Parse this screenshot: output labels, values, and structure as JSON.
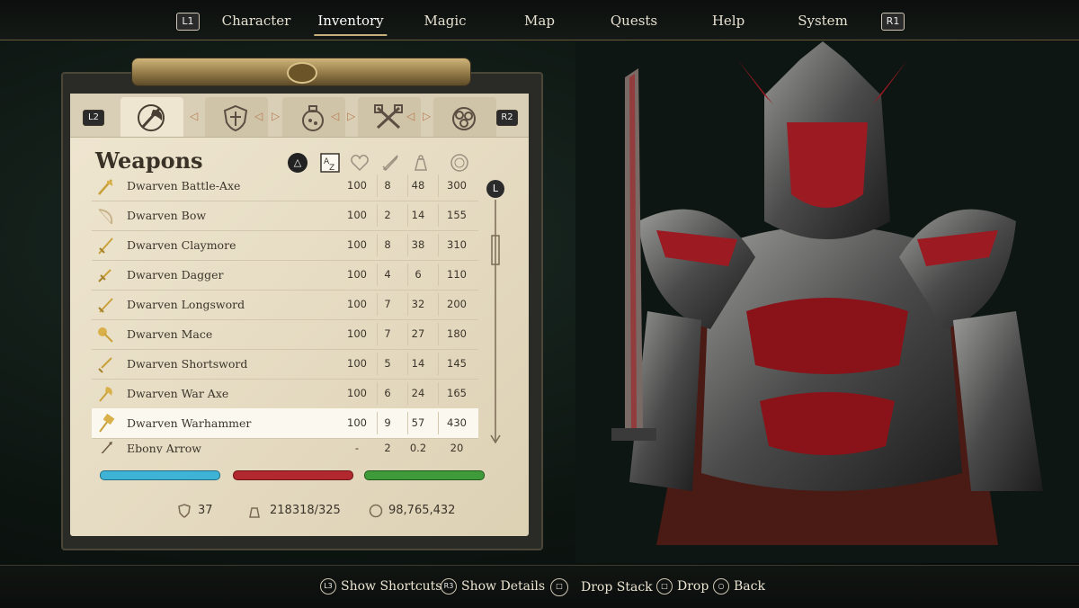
{
  "nav": {
    "left_button": "L1",
    "right_button": "R1",
    "tabs": [
      "Character",
      "Inventory",
      "Magic",
      "Map",
      "Quests",
      "Help",
      "System"
    ],
    "active_tab": "Inventory"
  },
  "panel": {
    "left_shoulder": "L2",
    "right_shoulder": "R2",
    "categories": [
      {
        "icon": "weapons-axe-icon",
        "active": true
      },
      {
        "icon": "armor-shield-icon",
        "active": false
      },
      {
        "icon": "potion-icon",
        "active": false
      },
      {
        "icon": "tools-icon",
        "active": false
      },
      {
        "icon": "ingredients-icon",
        "active": false
      }
    ],
    "title": "Weapons",
    "sort_button": "△",
    "column_icons": [
      "sort-az-icon",
      "condition-heart-icon",
      "damage-sword-icon",
      "weight-icon",
      "value-coin-icon"
    ],
    "items": [
      {
        "name": "Dwarven Battle-Axe",
        "icon": "battle-axe-icon",
        "condition": "100",
        "damage": "8",
        "weight": "48",
        "value": "300",
        "selected": false
      },
      {
        "name": "Dwarven Bow",
        "icon": "bow-icon",
        "condition": "100",
        "damage": "2",
        "weight": "14",
        "value": "155",
        "selected": false
      },
      {
        "name": "Dwarven Claymore",
        "icon": "claymore-icon",
        "condition": "100",
        "damage": "8",
        "weight": "38",
        "value": "310",
        "selected": false
      },
      {
        "name": "Dwarven Dagger",
        "icon": "dagger-icon",
        "condition": "100",
        "damage": "4",
        "weight": "6",
        "value": "110",
        "selected": false
      },
      {
        "name": "Dwarven Longsword",
        "icon": "longsword-icon",
        "condition": "100",
        "damage": "7",
        "weight": "32",
        "value": "200",
        "selected": false
      },
      {
        "name": "Dwarven Mace",
        "icon": "mace-icon",
        "condition": "100",
        "damage": "7",
        "weight": "27",
        "value": "180",
        "selected": false
      },
      {
        "name": "Dwarven Shortsword",
        "icon": "shortsword-icon",
        "condition": "100",
        "damage": "5",
        "weight": "14",
        "value": "145",
        "selected": false
      },
      {
        "name": "Dwarven War Axe",
        "icon": "war-axe-icon",
        "condition": "100",
        "damage": "6",
        "weight": "24",
        "value": "165",
        "selected": false
      },
      {
        "name": "Dwarven Warhammer",
        "icon": "warhammer-icon",
        "condition": "100",
        "damage": "9",
        "weight": "57",
        "value": "430",
        "selected": true
      },
      {
        "name": "Ebony Arrow",
        "icon": "arrow-icon",
        "condition": "-",
        "damage": "2",
        "weight": "0.2",
        "value": "20",
        "selected": false
      }
    ],
    "scroll_button": "L",
    "bars": [
      {
        "name": "magicka",
        "color": "#3fb3d6",
        "fill": 1.0
      },
      {
        "name": "health",
        "color": "#b1282e",
        "fill": 1.0
      },
      {
        "name": "fatigue",
        "color": "#3f9a3a",
        "fill": 1.0
      }
    ],
    "stats": {
      "armor": "37",
      "encumbrance": "218318/325",
      "gold": "98,765,432"
    }
  },
  "footer": {
    "hints": [
      {
        "button": "L3",
        "label": "Show Shortcuts"
      },
      {
        "button": "R3",
        "label": "Show Details"
      },
      {
        "button": "□",
        "label": "Drop Stack"
      },
      {
        "button": "□",
        "label": "Drop"
      },
      {
        "button": "○",
        "label": "Back"
      }
    ]
  }
}
